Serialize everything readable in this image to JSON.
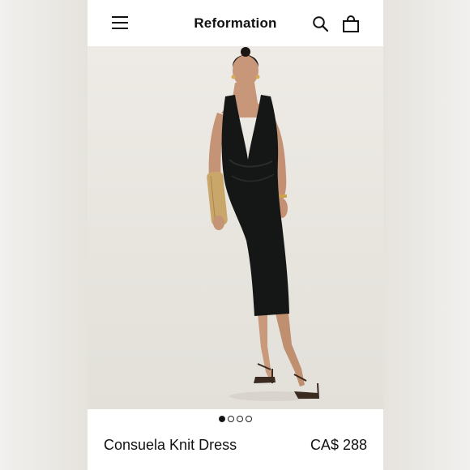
{
  "header": {
    "brand": "Reformation",
    "icons": {
      "menu": "hamburger-menu-icon",
      "search": "search-icon",
      "bag": "shopping-bag-icon"
    }
  },
  "gallery": {
    "image_subject": "model wearing black halter-neck knit midi dress",
    "slides": 4,
    "active_slide": 1
  },
  "product": {
    "name": "Consuela Knit Dress",
    "price": "CA$ 288"
  },
  "colors": {
    "dress": "#151716",
    "background": "#ece9e4",
    "accent": "#111111"
  }
}
